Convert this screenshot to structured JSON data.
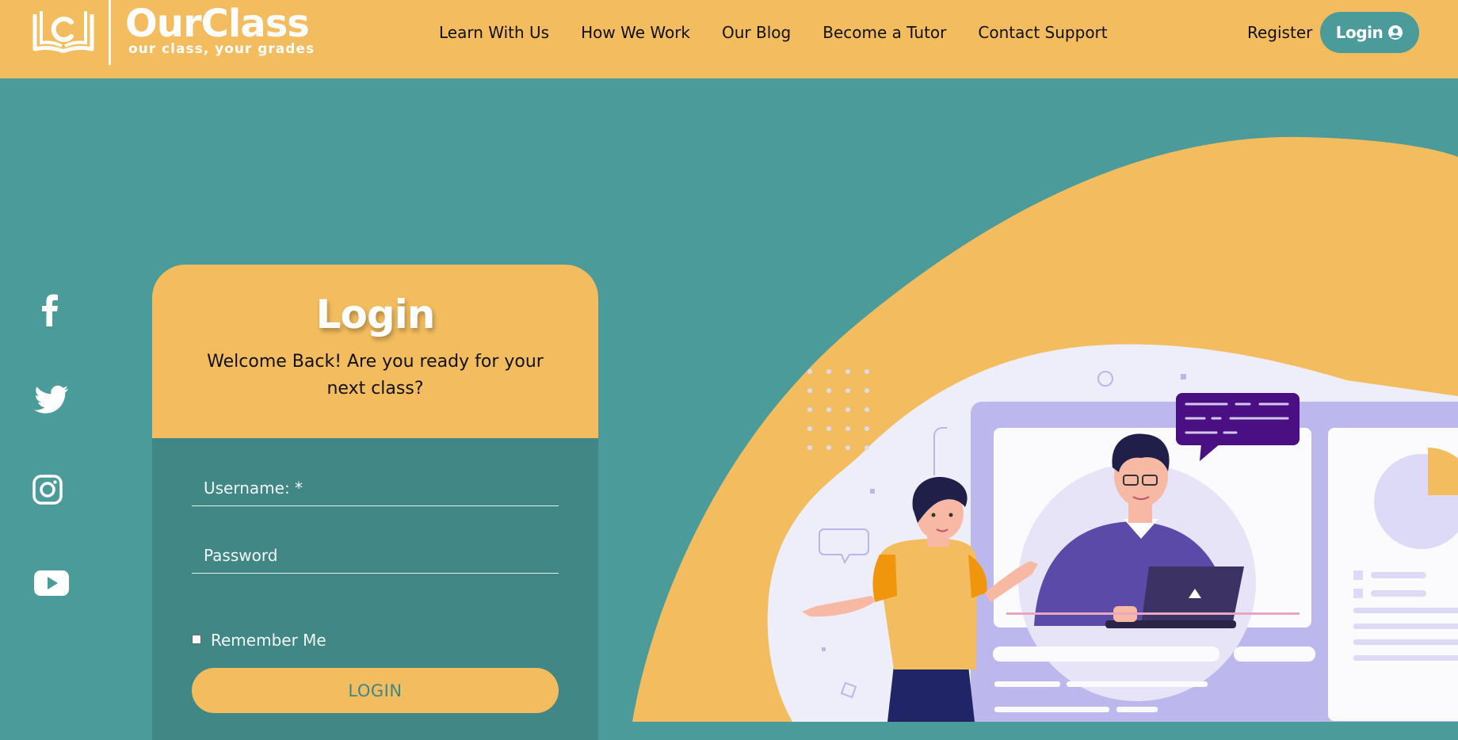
{
  "brand": {
    "name": "OurClass",
    "tagline": "our class, your grades",
    "logo_icon": "book-c-logo-icon"
  },
  "nav": {
    "items": [
      {
        "label": "Learn With Us"
      },
      {
        "label": "How We Work"
      },
      {
        "label": "Our Blog"
      },
      {
        "label": "Become a Tutor"
      },
      {
        "label": "Contact Support"
      }
    ],
    "register_label": "Register",
    "login_label": "Login",
    "login_icon": "user-circle-icon"
  },
  "social": [
    {
      "icon": "facebook-icon"
    },
    {
      "icon": "twitter-icon"
    },
    {
      "icon": "instagram-icon"
    },
    {
      "icon": "youtube-icon"
    }
  ],
  "login_card": {
    "title": "Login",
    "subtitle": "Welcome Back! Are you ready for your next class?",
    "username_placeholder": "Username: *",
    "password_placeholder": "Password",
    "remember_label": "Remember Me",
    "remember_checked": false,
    "submit_label": "LOGIN"
  },
  "colors": {
    "header_bg": "#f3bc5e",
    "page_bg": "#4c9b9b",
    "card_body_bg": "#418786",
    "accent_purple": "#5b4aa8"
  }
}
